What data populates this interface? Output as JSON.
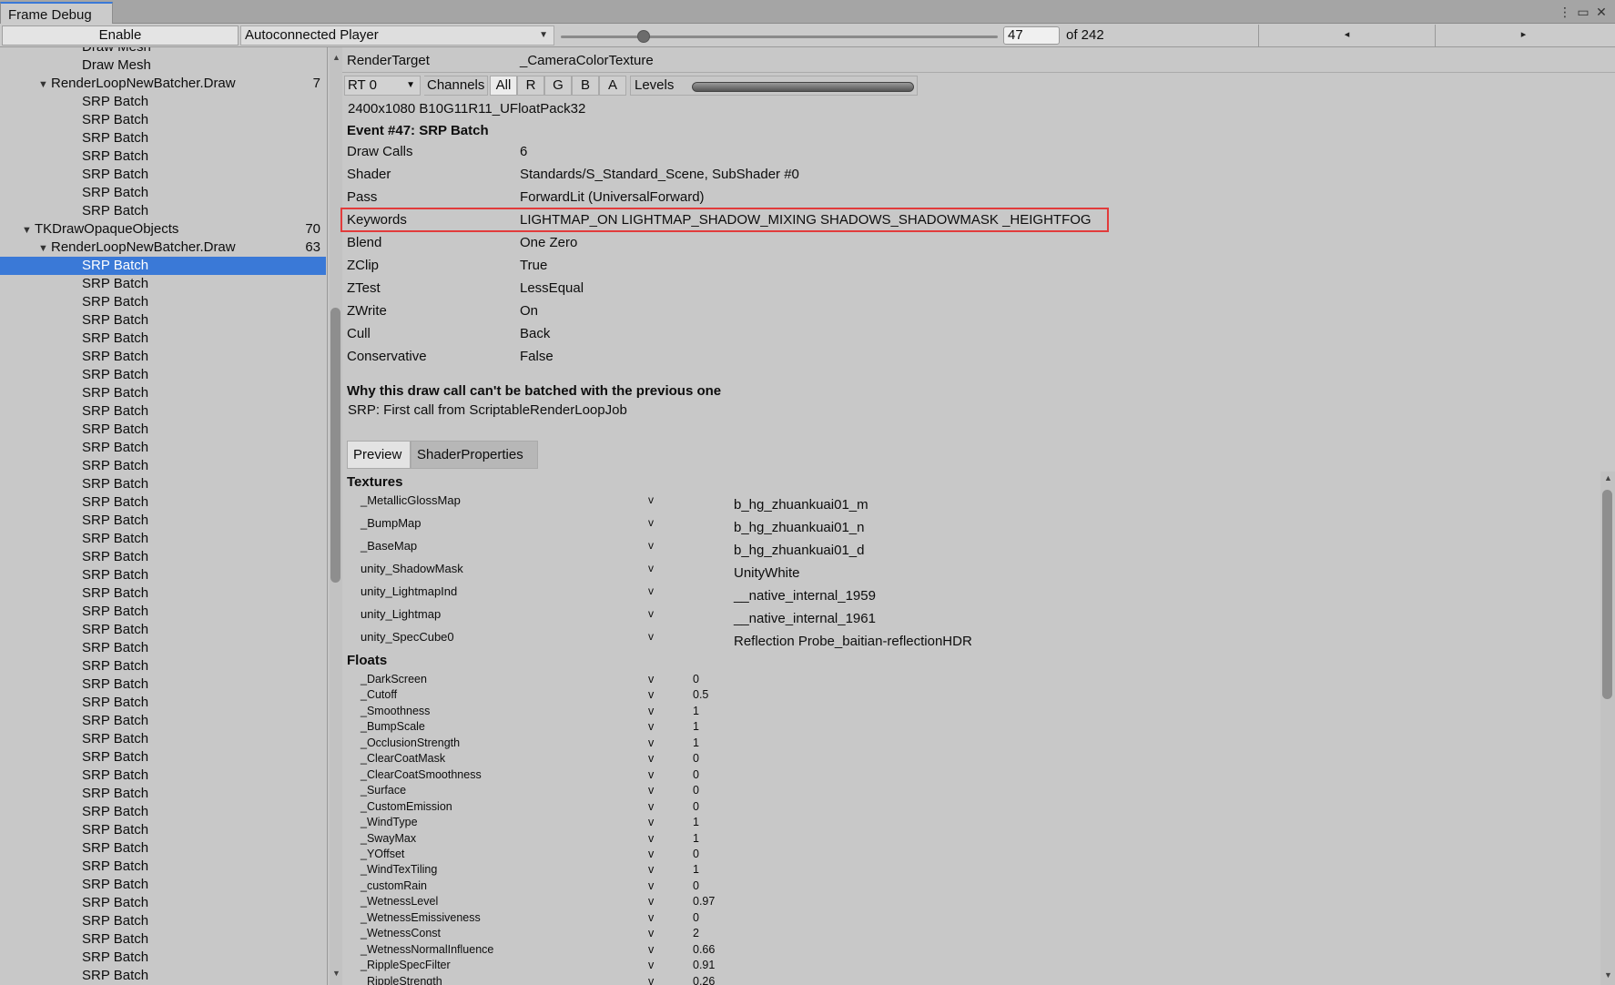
{
  "window": {
    "tab_title": "Frame Debug",
    "menu_icon": "kebab-menu-icon",
    "maximize_icon": "maximize-icon",
    "close_icon": "close-icon"
  },
  "toolbar": {
    "enable_label": "Enable",
    "player_label": "Autoconnected Player",
    "frame_value": "47",
    "frame_total": "of 242",
    "prev_icon": "◂",
    "next_icon": "▸",
    "slider_fraction": 0.19
  },
  "tree": {
    "rows": [
      {
        "label": "Draw Mesh",
        "indent": 2,
        "count": "",
        "expand": false,
        "selected": false,
        "partial": true
      },
      {
        "label": "Draw Mesh",
        "indent": 2,
        "count": "",
        "expand": false,
        "selected": false
      },
      {
        "label": "RenderLoopNewBatcher.Draw",
        "indent": 1,
        "count": "7",
        "expand": true,
        "selected": false
      },
      {
        "label": "SRP Batch",
        "indent": 2,
        "count": "",
        "expand": false,
        "selected": false
      },
      {
        "label": "SRP Batch",
        "indent": 2,
        "count": "",
        "expand": false,
        "selected": false
      },
      {
        "label": "SRP Batch",
        "indent": 2,
        "count": "",
        "expand": false,
        "selected": false
      },
      {
        "label": "SRP Batch",
        "indent": 2,
        "count": "",
        "expand": false,
        "selected": false
      },
      {
        "label": "SRP Batch",
        "indent": 2,
        "count": "",
        "expand": false,
        "selected": false
      },
      {
        "label": "SRP Batch",
        "indent": 2,
        "count": "",
        "expand": false,
        "selected": false
      },
      {
        "label": "SRP Batch",
        "indent": 2,
        "count": "",
        "expand": false,
        "selected": false
      },
      {
        "label": "TKDrawOpaqueObjects",
        "indent": 0,
        "count": "70",
        "expand": true,
        "selected": false
      },
      {
        "label": "RenderLoopNewBatcher.Draw",
        "indent": 1,
        "count": "63",
        "expand": true,
        "selected": false
      },
      {
        "label": "SRP Batch",
        "indent": 2,
        "count": "",
        "expand": false,
        "selected": true
      },
      {
        "label": "SRP Batch",
        "indent": 2,
        "count": "",
        "expand": false,
        "selected": false
      },
      {
        "label": "SRP Batch",
        "indent": 2,
        "count": "",
        "expand": false,
        "selected": false
      },
      {
        "label": "SRP Batch",
        "indent": 2,
        "count": "",
        "expand": false,
        "selected": false
      },
      {
        "label": "SRP Batch",
        "indent": 2,
        "count": "",
        "expand": false,
        "selected": false
      },
      {
        "label": "SRP Batch",
        "indent": 2,
        "count": "",
        "expand": false,
        "selected": false
      },
      {
        "label": "SRP Batch",
        "indent": 2,
        "count": "",
        "expand": false,
        "selected": false
      },
      {
        "label": "SRP Batch",
        "indent": 2,
        "count": "",
        "expand": false,
        "selected": false
      },
      {
        "label": "SRP Batch",
        "indent": 2,
        "count": "",
        "expand": false,
        "selected": false
      },
      {
        "label": "SRP Batch",
        "indent": 2,
        "count": "",
        "expand": false,
        "selected": false
      },
      {
        "label": "SRP Batch",
        "indent": 2,
        "count": "",
        "expand": false,
        "selected": false
      },
      {
        "label": "SRP Batch",
        "indent": 2,
        "count": "",
        "expand": false,
        "selected": false
      },
      {
        "label": "SRP Batch",
        "indent": 2,
        "count": "",
        "expand": false,
        "selected": false
      },
      {
        "label": "SRP Batch",
        "indent": 2,
        "count": "",
        "expand": false,
        "selected": false
      },
      {
        "label": "SRP Batch",
        "indent": 2,
        "count": "",
        "expand": false,
        "selected": false
      },
      {
        "label": "SRP Batch",
        "indent": 2,
        "count": "",
        "expand": false,
        "selected": false
      },
      {
        "label": "SRP Batch",
        "indent": 2,
        "count": "",
        "expand": false,
        "selected": false
      },
      {
        "label": "SRP Batch",
        "indent": 2,
        "count": "",
        "expand": false,
        "selected": false
      },
      {
        "label": "SRP Batch",
        "indent": 2,
        "count": "",
        "expand": false,
        "selected": false
      },
      {
        "label": "SRP Batch",
        "indent": 2,
        "count": "",
        "expand": false,
        "selected": false
      },
      {
        "label": "SRP Batch",
        "indent": 2,
        "count": "",
        "expand": false,
        "selected": false
      },
      {
        "label": "SRP Batch",
        "indent": 2,
        "count": "",
        "expand": false,
        "selected": false
      },
      {
        "label": "SRP Batch",
        "indent": 2,
        "count": "",
        "expand": false,
        "selected": false
      },
      {
        "label": "SRP Batch",
        "indent": 2,
        "count": "",
        "expand": false,
        "selected": false
      },
      {
        "label": "SRP Batch",
        "indent": 2,
        "count": "",
        "expand": false,
        "selected": false
      },
      {
        "label": "SRP Batch",
        "indent": 2,
        "count": "",
        "expand": false,
        "selected": false
      },
      {
        "label": "SRP Batch",
        "indent": 2,
        "count": "",
        "expand": false,
        "selected": false
      },
      {
        "label": "SRP Batch",
        "indent": 2,
        "count": "",
        "expand": false,
        "selected": false
      },
      {
        "label": "SRP Batch",
        "indent": 2,
        "count": "",
        "expand": false,
        "selected": false
      },
      {
        "label": "SRP Batch",
        "indent": 2,
        "count": "",
        "expand": false,
        "selected": false
      },
      {
        "label": "SRP Batch",
        "indent": 2,
        "count": "",
        "expand": false,
        "selected": false
      },
      {
        "label": "SRP Batch",
        "indent": 2,
        "count": "",
        "expand": false,
        "selected": false
      },
      {
        "label": "SRP Batch",
        "indent": 2,
        "count": "",
        "expand": false,
        "selected": false
      },
      {
        "label": "SRP Batch",
        "indent": 2,
        "count": "",
        "expand": false,
        "selected": false
      },
      {
        "label": "SRP Batch",
        "indent": 2,
        "count": "",
        "expand": false,
        "selected": false
      },
      {
        "label": "SRP Batch",
        "indent": 2,
        "count": "",
        "expand": false,
        "selected": false
      },
      {
        "label": "SRP Batch",
        "indent": 2,
        "count": "",
        "expand": false,
        "selected": false
      },
      {
        "label": "SRP Batch",
        "indent": 2,
        "count": "",
        "expand": false,
        "selected": false
      },
      {
        "label": "SRP Batch",
        "indent": 2,
        "count": "",
        "expand": false,
        "selected": false
      },
      {
        "label": "SRP Batch",
        "indent": 2,
        "count": "",
        "expand": false,
        "selected": false
      },
      {
        "label": "SRP Batch",
        "indent": 2,
        "count": "",
        "expand": false,
        "selected": false
      }
    ]
  },
  "render_target": {
    "label": "RenderTarget",
    "value": "_CameraColorTexture",
    "rt_select": "RT 0",
    "channels_label": "Channels",
    "channels": [
      "All",
      "R",
      "G",
      "B",
      "A"
    ],
    "active_channel": "All",
    "levels_label": "Levels",
    "format": "2400x1080 B10G11R11_UFloatPack32"
  },
  "event": {
    "title": "Event #47: SRP Batch",
    "properties": [
      {
        "key": "Draw Calls",
        "value": "6"
      },
      {
        "key": "Shader",
        "value": "Standards/S_Standard_Scene, SubShader #0"
      },
      {
        "key": "Pass",
        "value": "ForwardLit (UniversalForward)"
      },
      {
        "key": "Keywords",
        "value": "LIGHTMAP_ON LIGHTMAP_SHADOW_MIXING SHADOWS_SHADOWMASK _HEIGHTFOG"
      },
      {
        "key": "Blend",
        "value": "One Zero"
      },
      {
        "key": "ZClip",
        "value": "True"
      },
      {
        "key": "ZTest",
        "value": "LessEqual"
      },
      {
        "key": "ZWrite",
        "value": "On"
      },
      {
        "key": "Cull",
        "value": "Back"
      },
      {
        "key": "Conservative",
        "value": "False"
      }
    ],
    "why_title": "Why this draw call can't be batched with the previous one",
    "why_text": "SRP: First call from ScriptableRenderLoopJob"
  },
  "tabs": {
    "preview": "Preview",
    "shader_properties": "ShaderProperties"
  },
  "textures": {
    "title": "Textures",
    "rows": [
      {
        "name": "_MetallicGlossMap",
        "stage": "v",
        "texture": "b_hg_zhuankuai01_m"
      },
      {
        "name": "_BumpMap",
        "stage": "v",
        "texture": "b_hg_zhuankuai01_n"
      },
      {
        "name": "_BaseMap",
        "stage": "v",
        "texture": "b_hg_zhuankuai01_d"
      },
      {
        "name": "unity_ShadowMask",
        "stage": "v",
        "texture": "UnityWhite"
      },
      {
        "name": "unity_LightmapInd",
        "stage": "v",
        "texture": "__native_internal_1959"
      },
      {
        "name": "unity_Lightmap",
        "stage": "v",
        "texture": "__native_internal_1961"
      },
      {
        "name": "unity_SpecCube0",
        "stage": "v",
        "texture": "Reflection Probe_baitian-reflectionHDR"
      }
    ]
  },
  "floats": {
    "title": "Floats",
    "rows": [
      {
        "name": "_DarkScreen",
        "stage": "v",
        "value": "0"
      },
      {
        "name": "_Cutoff",
        "stage": "v",
        "value": "0.5"
      },
      {
        "name": "_Smoothness",
        "stage": "v",
        "value": "1"
      },
      {
        "name": "_BumpScale",
        "stage": "v",
        "value": "1"
      },
      {
        "name": "_OcclusionStrength",
        "stage": "v",
        "value": "1"
      },
      {
        "name": "_ClearCoatMask",
        "stage": "v",
        "value": "0"
      },
      {
        "name": "_ClearCoatSmoothness",
        "stage": "v",
        "value": "0"
      },
      {
        "name": "_Surface",
        "stage": "v",
        "value": "0"
      },
      {
        "name": "_CustomEmission",
        "stage": "v",
        "value": "0"
      },
      {
        "name": "_WindType",
        "stage": "v",
        "value": "1"
      },
      {
        "name": "_SwayMax",
        "stage": "v",
        "value": "1"
      },
      {
        "name": "_YOffset",
        "stage": "v",
        "value": "0"
      },
      {
        "name": "_WindTexTiling",
        "stage": "v",
        "value": "1"
      },
      {
        "name": "_customRain",
        "stage": "v",
        "value": "0"
      },
      {
        "name": "_WetnessLevel",
        "stage": "v",
        "value": "0.97"
      },
      {
        "name": "_WetnessEmissiveness",
        "stage": "v",
        "value": "0"
      },
      {
        "name": "_WetnessConst",
        "stage": "v",
        "value": "2"
      },
      {
        "name": "_WetnessNormalInfluence",
        "stage": "v",
        "value": "0.66"
      },
      {
        "name": "_RippleSpecFilter",
        "stage": "v",
        "value": "0.91"
      },
      {
        "name": "_RippleStrength",
        "stage": "v",
        "value": "0.26"
      }
    ]
  },
  "colors": {
    "selection": "#3a79d7",
    "highlight_border": "#e23b3b",
    "background": "#c8c8c8"
  }
}
